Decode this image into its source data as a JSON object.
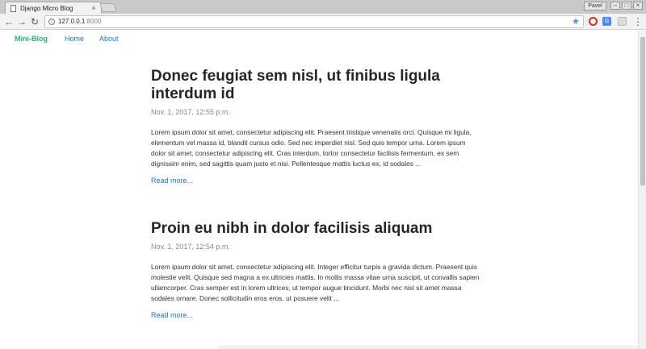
{
  "browser": {
    "tab_title": "Django Micro Blog",
    "tab_close": "×",
    "profile_label": "Pavel",
    "window_buttons": [
      "−",
      "□",
      "×"
    ],
    "url_host": "127.0.0.1",
    "url_port": ":8000",
    "nav": {
      "back": "←",
      "forward": "→",
      "reload": "↻"
    },
    "bookmark_star": "★",
    "menu": "⋮"
  },
  "site": {
    "brand": "Mini-Blog",
    "nav_links": [
      "Home",
      "About"
    ]
  },
  "posts": [
    {
      "title": "Donec feugiat sem nisl, ut finibus ligula interdum id",
      "date": "Nov. 1, 2017, 12:55 p.m.",
      "excerpt": "Lorem ipsum dolor sit amet, consectetur adipiscing elit. Praesent tristique venenatis orci. Quisque mi ligula, elementum vel massa id, blandit cursus odio. Sed nec imperdiet nisl. Sed quis tempor urna. Lorem ipsum dolor sit amet, consectetur adipiscing elit. Cras interdum, tortor consectetur facilisis fermentum, ex sem dignissim enim, sed sagittis quam justo et nisi. Pellentesque mattis luctus ex, id sodales ...",
      "read_more": "Read more..."
    },
    {
      "title": "Proin eu nibh in dolor facilisis aliquam",
      "date": "Nov. 1, 2017, 12:54 p.m.",
      "excerpt": "Lorem ipsum dolor sit amet, consectetur adipiscing elit. Integer efficitur turpis a gravida dictum. Praesent quis molestie velit. Quisque sed magna a ex ultricies mattis. In mollis massa vitae urna suscipit, ut convallis sapien ullamcorper. Cras semper est in lorem ultrices, ut tempor augue tincidunt. Morbi nec nisl sit amet massa sodales ornare. Donec sollicitudin eros eros, ut posuere velit ...",
      "read_more": "Read more..."
    }
  ],
  "colors": {
    "brand": "#25b17e",
    "link": "#1b74c9",
    "title": "#252525",
    "date": "#8a8a8a"
  }
}
